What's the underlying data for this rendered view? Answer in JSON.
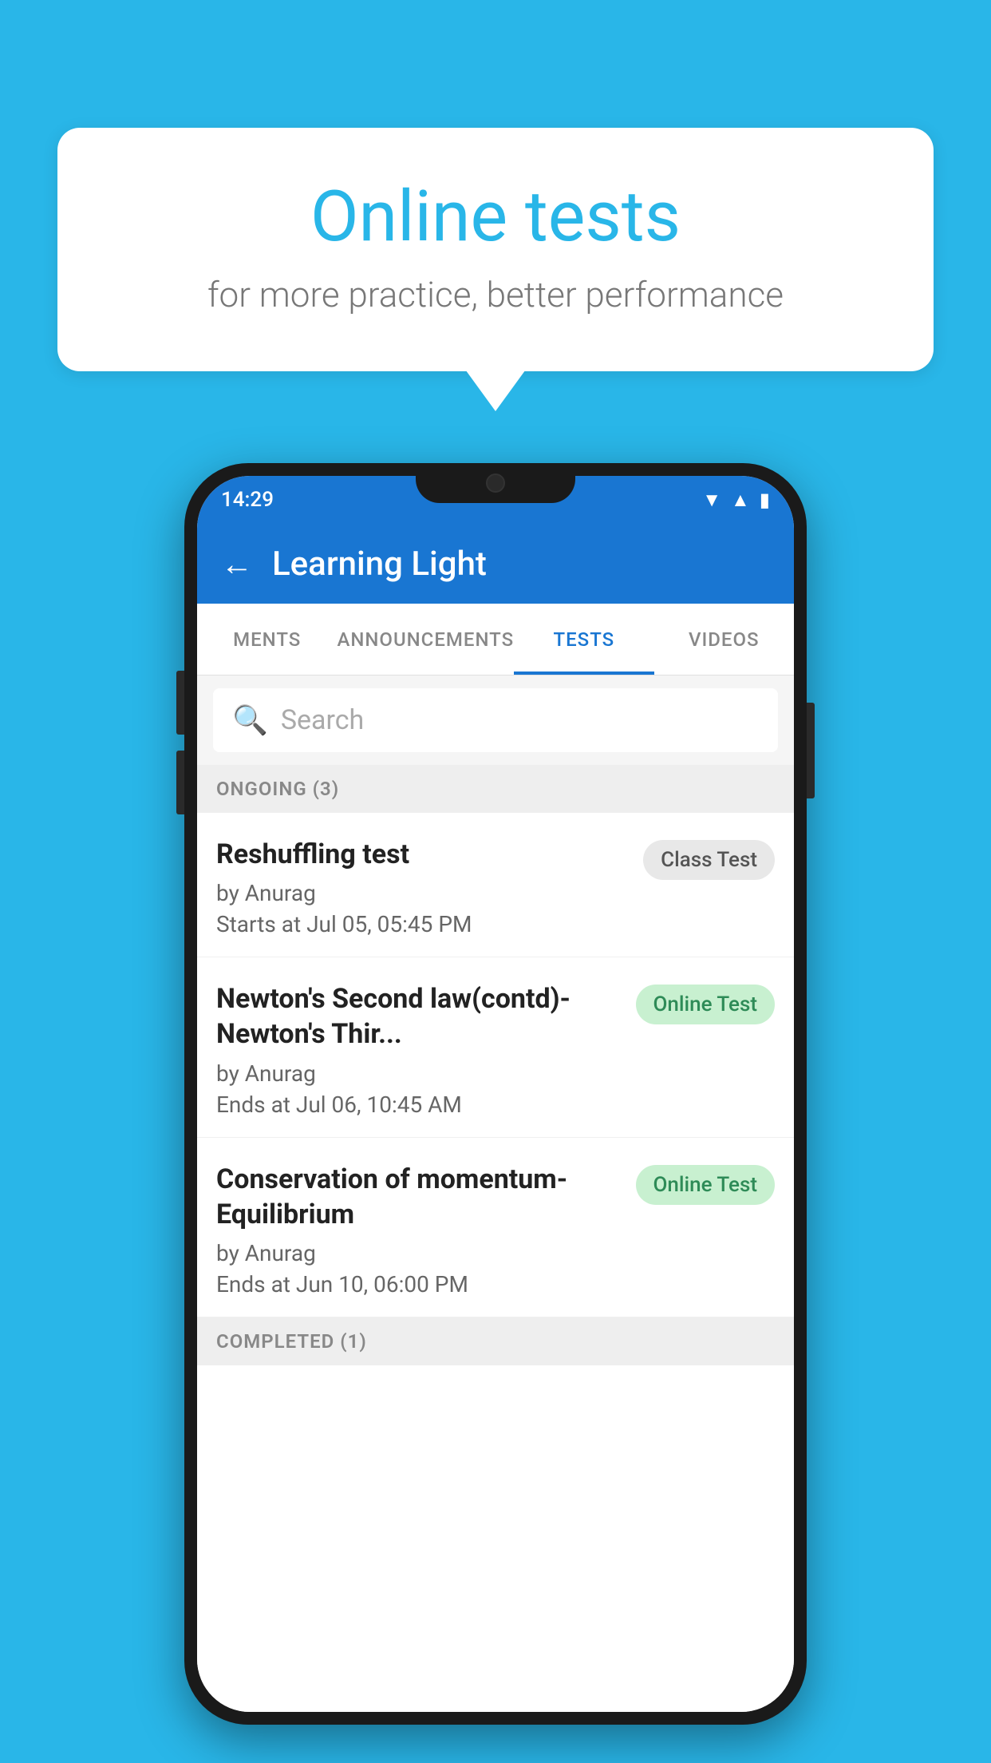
{
  "background_color": "#29b6e8",
  "bubble": {
    "title": "Online tests",
    "subtitle": "for more practice, better performance"
  },
  "phone": {
    "status_bar": {
      "time": "14:29",
      "icons": [
        "wifi",
        "signal",
        "battery"
      ]
    },
    "app_bar": {
      "title": "Learning Light",
      "back_label": "←"
    },
    "tabs": [
      {
        "label": "MENTS",
        "active": false
      },
      {
        "label": "ANNOUNCEMENTS",
        "active": false
      },
      {
        "label": "TESTS",
        "active": true
      },
      {
        "label": "VIDEOS",
        "active": false
      }
    ],
    "search": {
      "placeholder": "Search"
    },
    "ongoing_section": {
      "label": "ONGOING (3)"
    },
    "tests": [
      {
        "title": "Reshuffling test",
        "author": "by Anurag",
        "time": "Starts at  Jul 05, 05:45 PM",
        "badge": "Class Test",
        "badge_type": "class"
      },
      {
        "title": "Newton's Second law(contd)-Newton's Thir...",
        "author": "by Anurag",
        "time": "Ends at  Jul 06, 10:45 AM",
        "badge": "Online Test",
        "badge_type": "online"
      },
      {
        "title": "Conservation of momentum-Equilibrium",
        "author": "by Anurag",
        "time": "Ends at  Jun 10, 06:00 PM",
        "badge": "Online Test",
        "badge_type": "online"
      }
    ],
    "completed_section": {
      "label": "COMPLETED (1)"
    }
  }
}
